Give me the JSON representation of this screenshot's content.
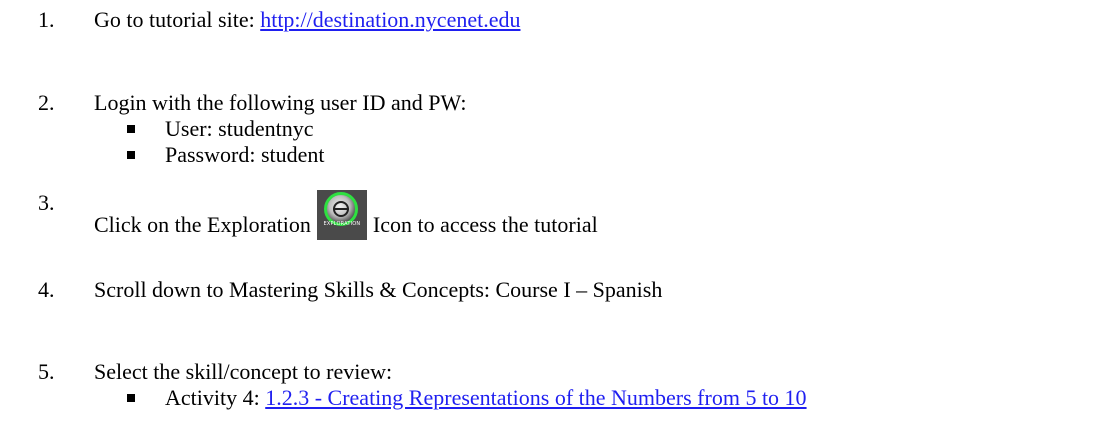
{
  "steps": [
    {
      "number": "1.",
      "text": "Go to tutorial site: ",
      "link": "http://destination.nycenet.edu"
    },
    {
      "number": "2.",
      "text": "Login with the following user ID and PW:",
      "subitems": [
        "User: studentnyc",
        "Password: student"
      ]
    },
    {
      "number": "3.",
      "text_before": "Click on the Exploration",
      "text_after": "Icon to access the tutorial",
      "icon": {
        "name": "exploration-icon",
        "caption": "EXPLORATION",
        "ring_color": "#2ee040"
      }
    },
    {
      "number": "4.",
      "text": "Scroll down to Mastering Skills & Concepts: Course I – Spanish"
    },
    {
      "number": "5.",
      "text": "Select the skill/concept to review:",
      "subitems": [
        {
          "prefix": "Activity 4: ",
          "link": "1.2.3 - Creating Representations of the Numbers from 5 to 10"
        }
      ]
    }
  ],
  "colors": {
    "link": "#1f1ff0",
    "text": "#000000",
    "background": "#ffffff"
  }
}
